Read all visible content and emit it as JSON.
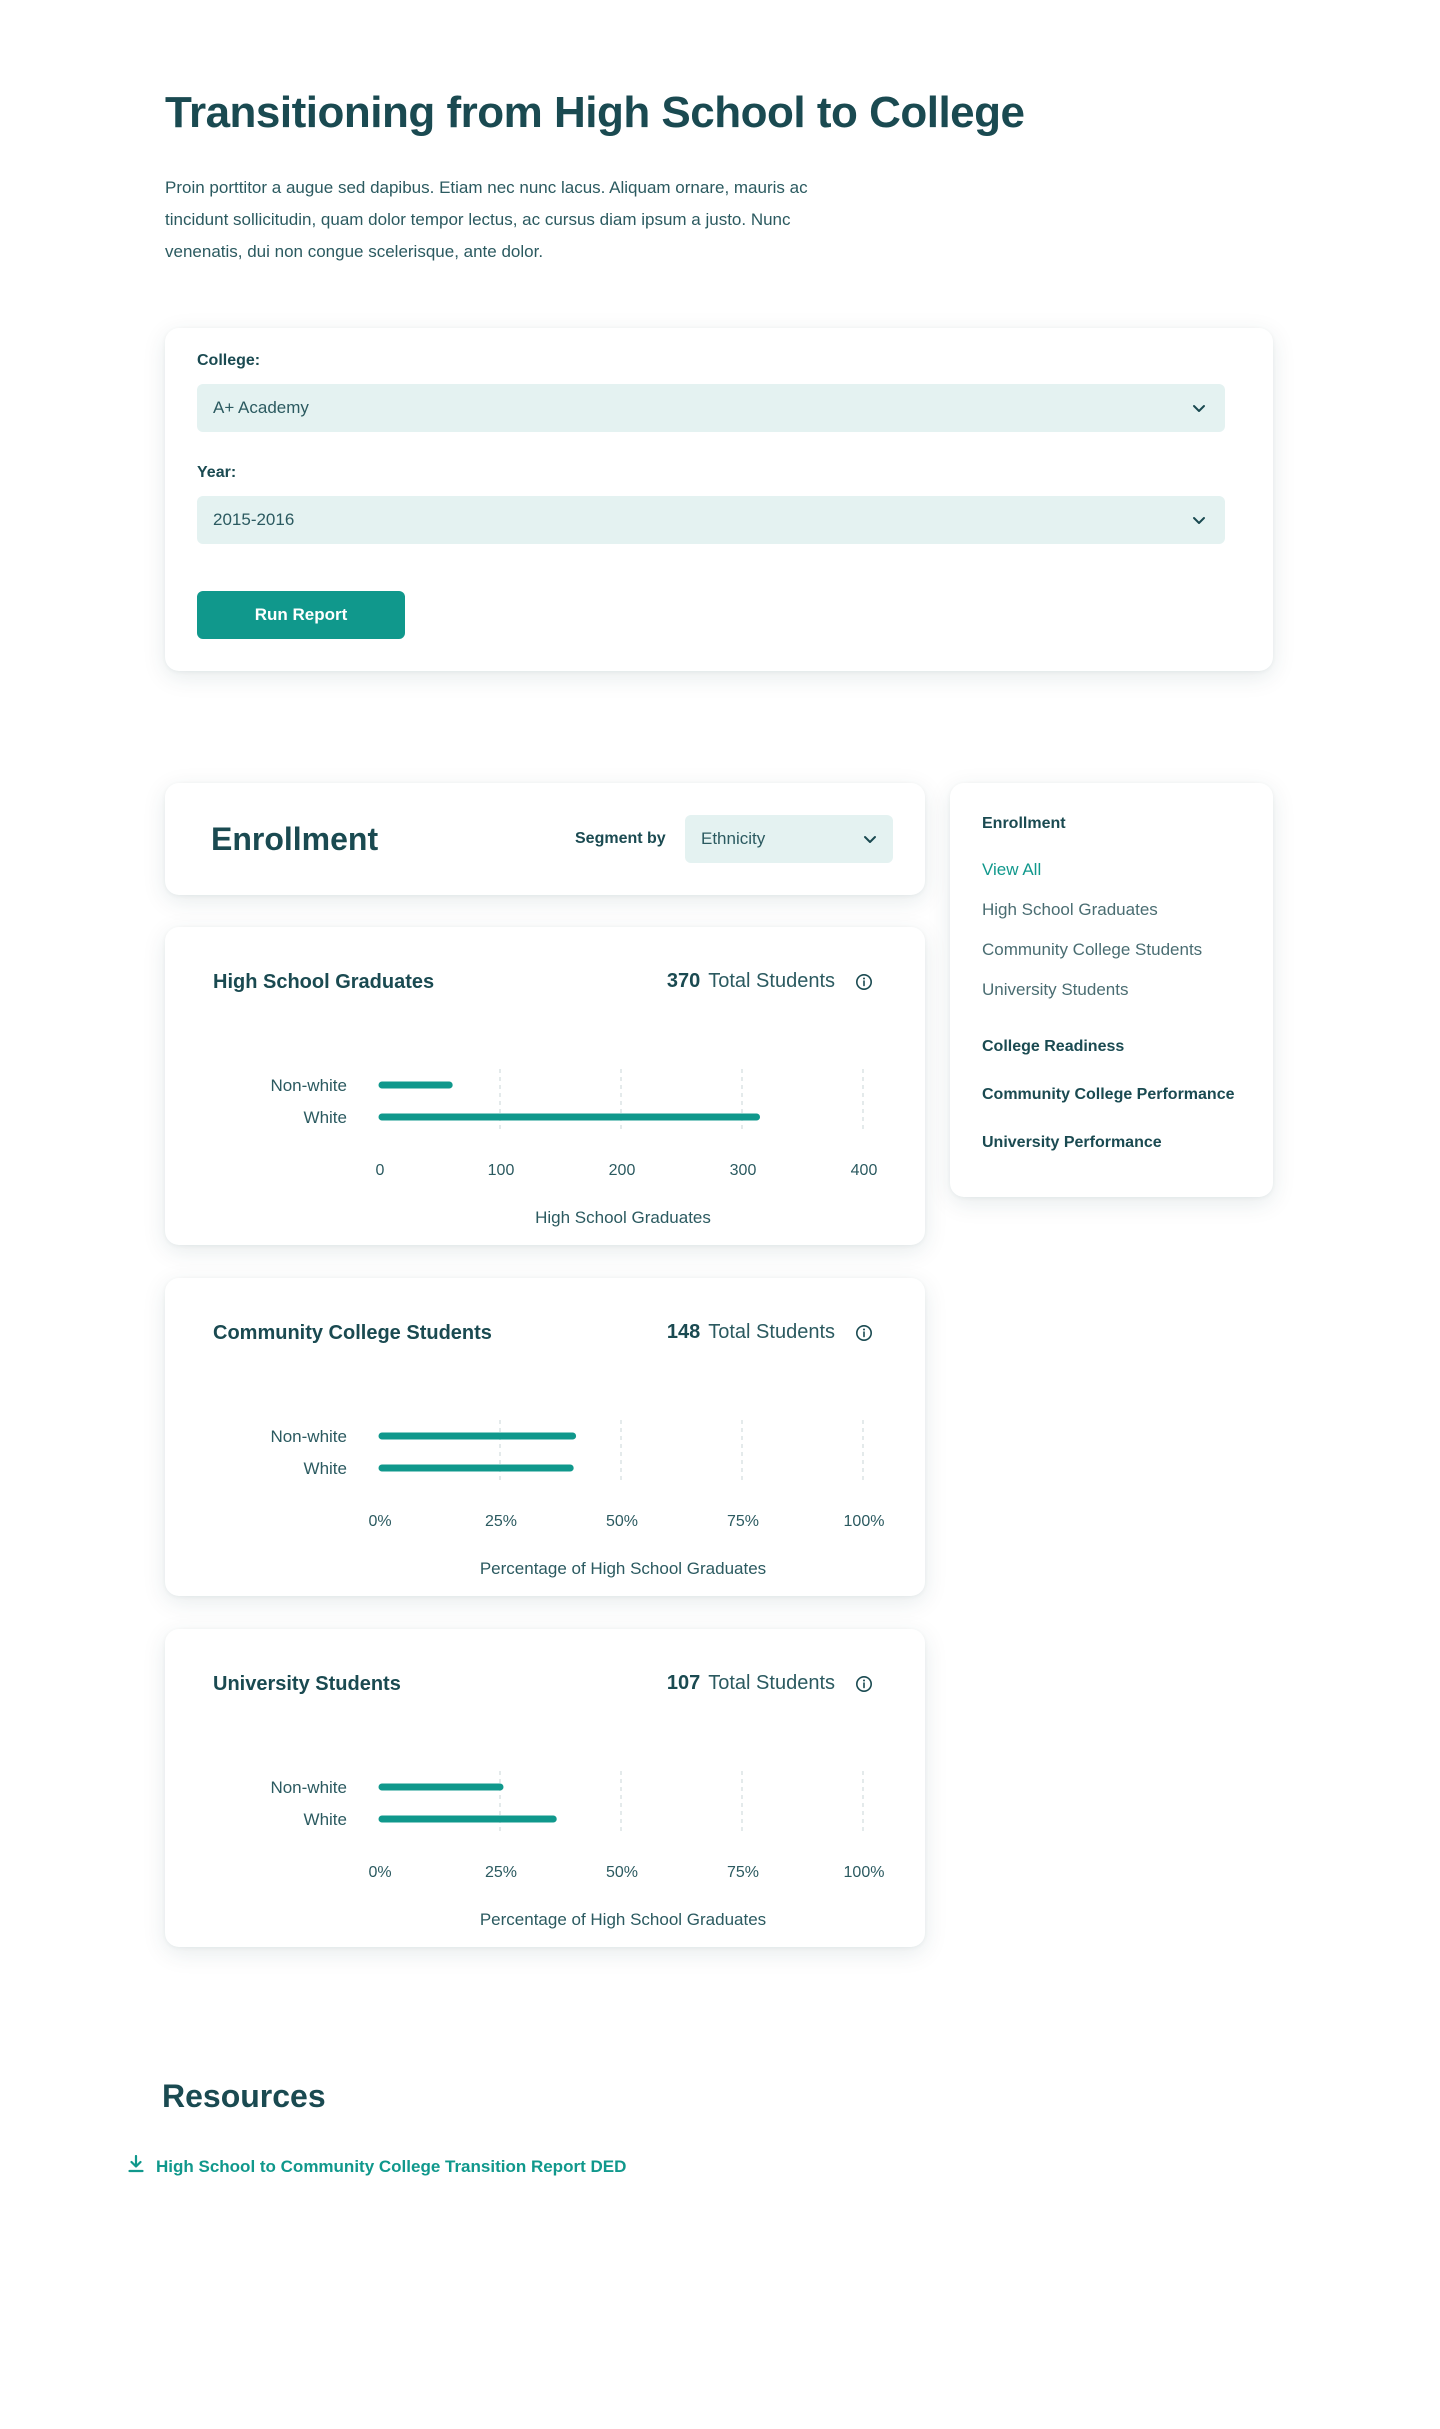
{
  "page": {
    "title": "Transitioning from High School to College",
    "intro": "Proin porttitor a augue sed dapibus. Etiam nec nunc lacus. Aliquam ornare, mauris ac tincidunt sollicitudin, quam dolor tempor lectus, ac cursus diam ipsum a justo. Nunc venenatis, dui non congue scelerisque, ante dolor."
  },
  "filters": {
    "college_label": "College:",
    "college_value": "A+ Academy",
    "year_label": "Year:",
    "year_value": "2015-2016",
    "run_label": "Run Report"
  },
  "enrollment": {
    "title": "Enrollment",
    "segment_label": "Segment by",
    "segment_value": "Ethnicity"
  },
  "sidenav": {
    "enrollment_head": "Enrollment",
    "links": [
      "View All",
      "High School Graduates",
      "Community College Students",
      "University Students"
    ],
    "sections": [
      "College Readiness",
      "Community College Performance",
      "University Performance"
    ]
  },
  "resources": {
    "title": "Resources",
    "link": "High School to Community College Transition Report DED"
  },
  "colors": {
    "accent": "#10988c",
    "heading": "#1a4a51",
    "field_bg": "#e4f2f1"
  },
  "chart_data": [
    {
      "type": "bar",
      "orientation": "horizontal",
      "title": "High School Graduates",
      "total_value": "370",
      "total_label": "Total Students",
      "categories": [
        "Non-white",
        "White"
      ],
      "values": [
        58,
        312
      ],
      "xlim": [
        0,
        400
      ],
      "ticks": [
        "0",
        "100",
        "200",
        "300",
        "400"
      ],
      "tick_values": [
        0,
        100,
        200,
        300,
        400
      ],
      "xlabel": "High School Graduates"
    },
    {
      "type": "bar",
      "orientation": "horizontal",
      "title": "Community College Students",
      "total_value": "148",
      "total_label": "Total Students",
      "categories": [
        "Non-white",
        "White"
      ],
      "values": [
        40,
        39.5
      ],
      "xlim": [
        0,
        100
      ],
      "ticks": [
        "0%",
        "25%",
        "50%",
        "75%",
        "100%"
      ],
      "tick_values": [
        0,
        25,
        50,
        75,
        100
      ],
      "xlabel": "Percentage of High School Graduates"
    },
    {
      "type": "bar",
      "orientation": "horizontal",
      "title": "University Students",
      "total_value": "107",
      "total_label": "Total Students",
      "categories": [
        "Non-white",
        "White"
      ],
      "values": [
        25,
        36
      ],
      "xlim": [
        0,
        100
      ],
      "ticks": [
        "0%",
        "25%",
        "50%",
        "75%",
        "100%"
      ],
      "tick_values": [
        0,
        25,
        50,
        75,
        100
      ],
      "xlabel": "Percentage of High School Graduates"
    }
  ]
}
